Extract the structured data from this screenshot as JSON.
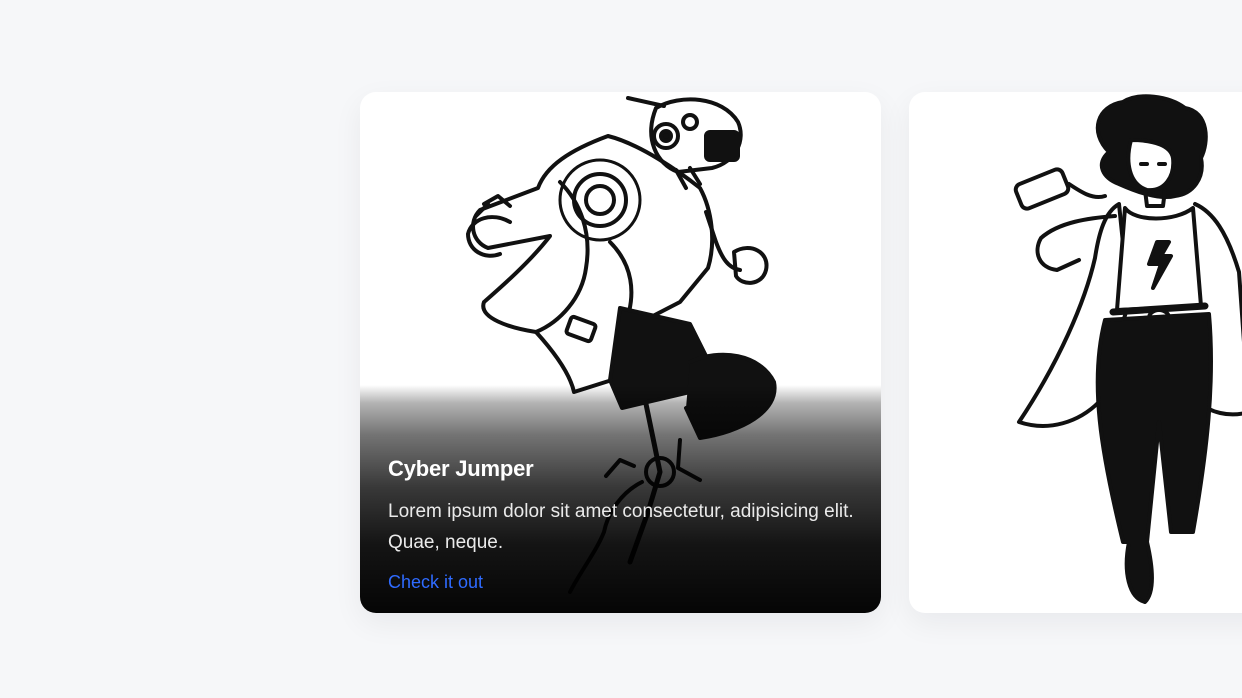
{
  "cards": [
    {
      "title": "Cyber Jumper",
      "description": "Lorem ipsum dolor sit amet consectetur, adipisicing elit. Quae, neque.",
      "link_label": "Check it out",
      "illustration": "robot-jumper-illustration"
    },
    {
      "illustration": "scientist-woman-illustration"
    }
  ],
  "colors": {
    "page_background": "#f6f7f9",
    "card_background": "#ffffff",
    "link": "#2f6bff",
    "title_text": "#ffffff"
  }
}
